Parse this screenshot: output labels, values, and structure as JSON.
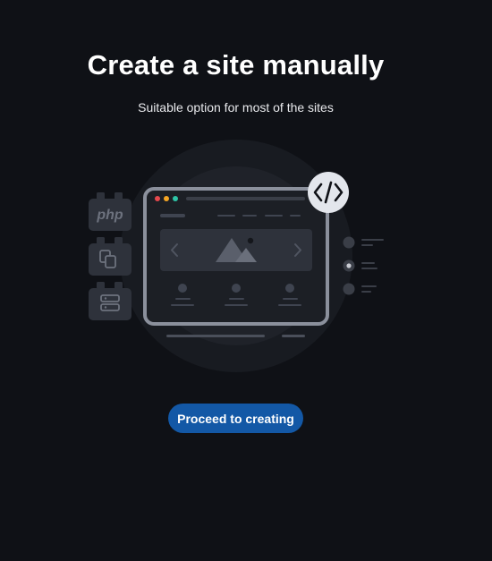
{
  "header": {
    "title": "Create a site manually",
    "subtitle": "Suitable option for most of the sites"
  },
  "illustration": {
    "php_label": "php",
    "code_badge": "</>",
    "icons": [
      "php-icon",
      "copy-icon",
      "server-icon",
      "code-icon",
      "image-icon",
      "chevron-left-icon",
      "chevron-right-icon"
    ],
    "colors": {
      "background": "#0f1116",
      "circle_outer": "#181b21",
      "circle_inner": "#1f2229",
      "frame": "#8b909c",
      "tile": "#2e323b",
      "dot_red": "#e5484d",
      "dot_yellow": "#f5a524",
      "dot_green": "#2ec4a6",
      "badge": "#e3e6ec"
    }
  },
  "actions": {
    "proceed_label": "Proceed to creating",
    "accent": "#1358a6"
  }
}
